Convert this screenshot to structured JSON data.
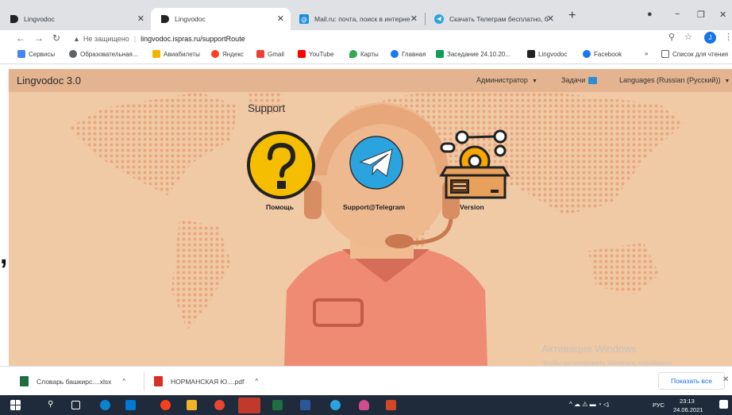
{
  "browser": {
    "tabs": [
      {
        "title": "Lingvodoc",
        "active": false
      },
      {
        "title": "Lingvodoc",
        "active": true
      },
      {
        "title": "Mail.ru: почта, поиск в интерне",
        "active": false
      },
      {
        "title": "Скачать Телеграм бесплатно, б",
        "active": false
      }
    ],
    "new_tab_label": "+",
    "address": {
      "not_secure_label": "Не защищено",
      "url": "lingvodoc.ispras.ru/supportRoute"
    },
    "profile_initial": "J",
    "bookmarks": [
      {
        "label": "Сервисы",
        "color": "#4285f4"
      },
      {
        "label": "Образовательная...",
        "color": "#5f6368"
      },
      {
        "label": "Авиабилеты",
        "color": "#f4b400"
      },
      {
        "label": "Яндекс",
        "color": "#fc3f1d"
      },
      {
        "label": "Gmail",
        "color": "#ea4335"
      },
      {
        "label": "YouTube",
        "color": "#ff0000"
      },
      {
        "label": "Карты",
        "color": "#34a853"
      },
      {
        "label": "Главная",
        "color": "#1877f2"
      },
      {
        "label": "Заседание 24.10.20...",
        "color": "#0f9d58"
      },
      {
        "label": "Lingvodoc",
        "color": "#222222"
      },
      {
        "label": "Facebook",
        "color": "#1877f2"
      }
    ],
    "bookmarks_overflow": "»",
    "reading_list": "Список для чтения"
  },
  "app": {
    "brand": "Lingvodoc 3.0",
    "menu": {
      "admin": "Администратор",
      "tasks": "Задачи",
      "languages": "Languages (Russian (Русский))"
    },
    "support": {
      "title": "Support",
      "cards": [
        {
          "label": "Помощь",
          "icon": "question-icon"
        },
        {
          "label": "Support@Telegram",
          "icon": "telegram-icon"
        },
        {
          "label": "Version",
          "icon": "version-box-icon"
        }
      ]
    }
  },
  "windows_watermark": {
    "title": "Активация Windows",
    "line": "Чтобы активировать Windows, перейдите в раздел \"Параметры\"."
  },
  "downloads": {
    "items": [
      {
        "name": "Словарь башкирс....xlsx",
        "color": "#1d6f42"
      },
      {
        "name": "НОРМАНСКАЯ Ю....pdf",
        "color": "#d93025"
      }
    ],
    "show_all": "Показать все",
    "close": "✕"
  },
  "taskbar": {
    "lang": "РУС",
    "time": "23:13",
    "date": "24.06.2021"
  },
  "colors": {
    "app_bar": "#e3b48f",
    "content_bg": "#f0c9a5",
    "map_dots": "#e9a77d",
    "person": "#ef8a73"
  }
}
